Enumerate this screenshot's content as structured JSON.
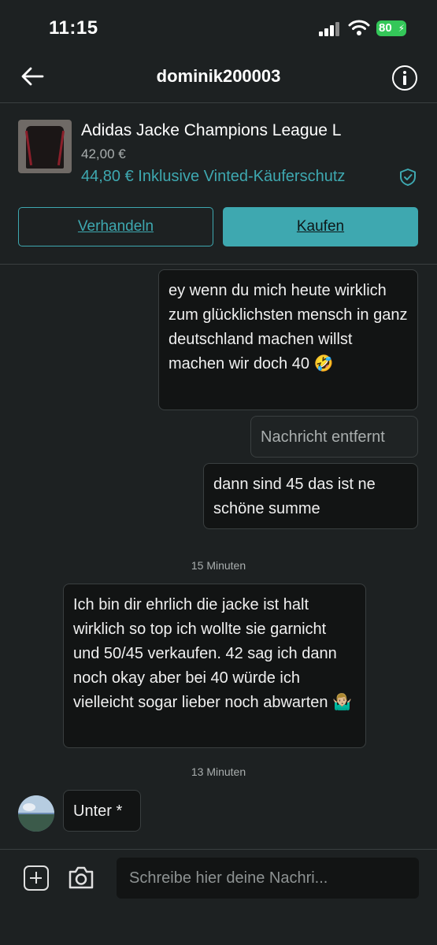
{
  "status_bar": {
    "time": "11:15",
    "battery": "80"
  },
  "header": {
    "title": "dominik200003"
  },
  "item": {
    "title": "Adidas Jacke Champions League L",
    "price": "42,00 €",
    "protected_price": "44,80 € Inklusive Vinted-Käuferschutz"
  },
  "actions": {
    "negotiate": "Verhandeln",
    "buy": "Kaufen"
  },
  "messages": [
    {
      "text": "ey wenn du mich heute wirklich zum glücklichsten mensch in ganz deutschland machen willst machen wir doch 40 🤣"
    },
    {
      "text": "Nachricht entfernt"
    },
    {
      "text": "dann sind 45 das ist ne schöne summe"
    },
    {
      "text": "Ich bin dir ehrlich die jacke ist halt wirklich so top ich wollte sie garnicht und 50/45 verkaufen. 42 sag ich dann noch okay aber bei 40 würde ich vielleicht sogar lieber noch abwarten 🤷🏼‍♂️"
    },
    {
      "text": "Unter *"
    }
  ],
  "timestamps": [
    "15 Minuten",
    "13 Minuten"
  ],
  "composer": {
    "placeholder": "Schreibe hier deine Nachri..."
  },
  "colors": {
    "accent": "#3ea8b0",
    "background": "#1d2122",
    "bubble": "#121414",
    "battery": "#34c759"
  },
  "icons": [
    "back-arrow-icon",
    "info-icon",
    "shield-check-icon",
    "plus-square-icon",
    "camera-icon",
    "cellular-signal-icon",
    "wifi-icon",
    "battery-icon"
  ]
}
